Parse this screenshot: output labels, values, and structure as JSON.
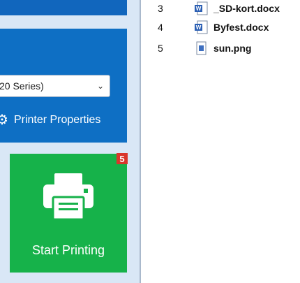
{
  "printer_panel": {
    "selected_printer": "20 Series)",
    "properties_label": "Printer Properties"
  },
  "start_tile": {
    "badge": "5",
    "label": "Start Printing"
  },
  "files": [
    {
      "number": "3",
      "name": "_SD-kort.docx",
      "icon": "word-doc-icon"
    },
    {
      "number": "4",
      "name": "Byfest.docx",
      "icon": "word-doc-icon"
    },
    {
      "number": "5",
      "name": "sun.png",
      "icon": "image-file-icon"
    }
  ],
  "colors": {
    "panel_blue": "#0e6fc4",
    "start_green": "#16b24a",
    "badge_red": "#d9362c",
    "pane_bg": "#d9e7f6"
  }
}
